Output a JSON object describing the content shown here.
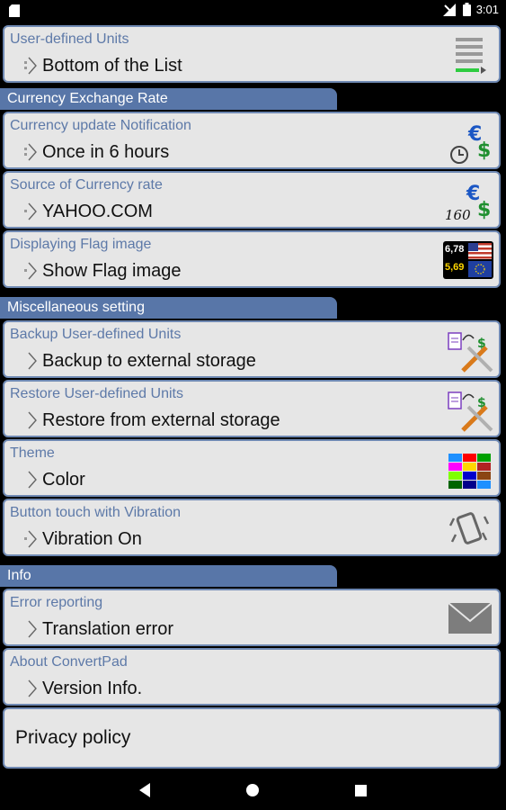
{
  "status_bar": {
    "time": "3:01"
  },
  "items_top": [
    {
      "title": "User-defined Units",
      "value": "Bottom of the List",
      "icon": "list-bottom-icon"
    }
  ],
  "sections": [
    {
      "header": "Currency Exchange Rate",
      "items": [
        {
          "title": "Currency update Notification",
          "value": "Once in 6 hours",
          "icon": "clock-currency-icon"
        },
        {
          "title": "Source of Currency rate",
          "value": "YAHOO.COM",
          "icon": "currency-source-icon",
          "icon_text": "160"
        },
        {
          "title": "Displaying Flag image",
          "value": "Show Flag image",
          "icon": "flag-image-icon",
          "icon_text_top": "6,78",
          "icon_text_bottom": "5,69"
        }
      ]
    },
    {
      "header": "Miscellaneous setting",
      "items": [
        {
          "title": "Backup User-defined Units",
          "value": "Backup to external storage",
          "icon": "backup-tools-icon"
        },
        {
          "title": "Restore User-defined Units",
          "value": "Restore from external storage",
          "icon": "restore-tools-icon"
        },
        {
          "title": "Theme",
          "value": "Color",
          "icon": "color-palette-icon"
        },
        {
          "title": "Button touch with Vibration",
          "value": "Vibration On",
          "icon": "vibration-icon"
        }
      ]
    },
    {
      "header": "Info",
      "items": [
        {
          "title": "Error reporting",
          "value": "Translation error",
          "icon": "envelope-icon"
        },
        {
          "title": "About ConvertPad",
          "value": "Version Info.",
          "icon": ""
        }
      ]
    }
  ],
  "privacy": {
    "label": "Privacy policy"
  },
  "theme_colors": [
    "#1e90ff",
    "#ff0000",
    "#00a000",
    "#ff00ff",
    "#ffd700",
    "#b22222",
    "#7fff00",
    "#0000cd",
    "#8b4513",
    "#006400",
    "#00008b"
  ],
  "colors": {
    "header_bg": "#5876a8",
    "card_border": "#6f89b3",
    "title_text": "#5d79a8",
    "card_bg": "#e6e6e6"
  }
}
